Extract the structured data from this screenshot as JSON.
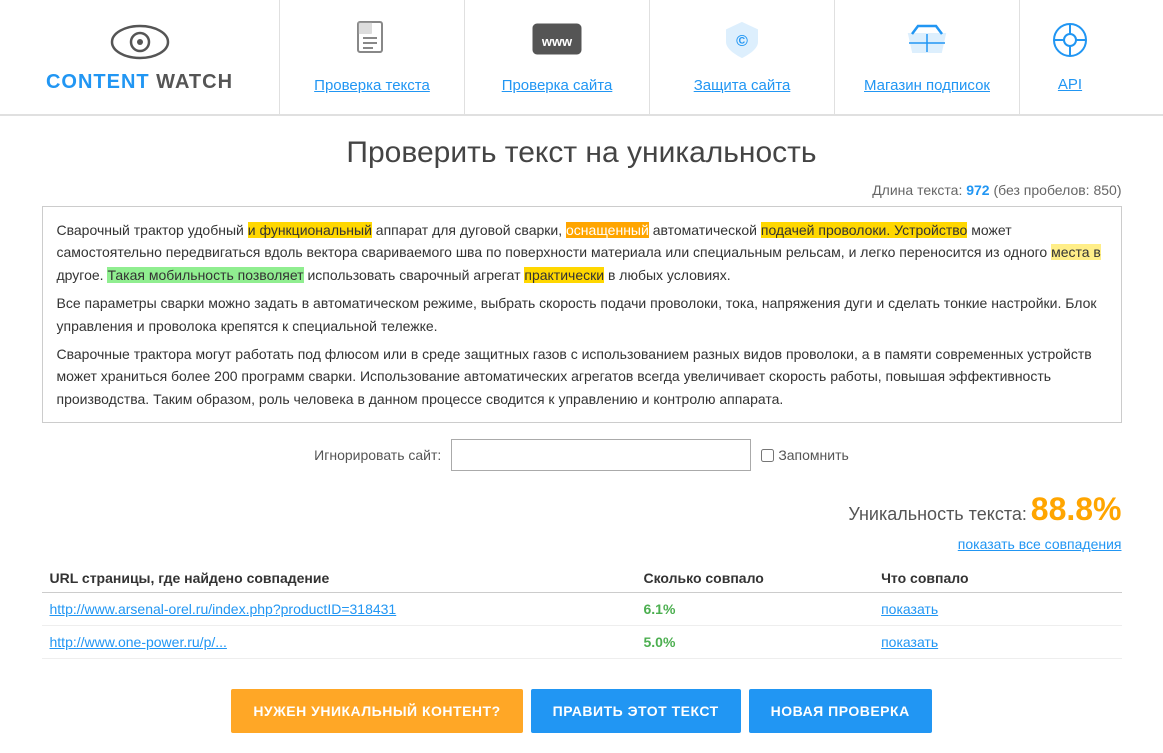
{
  "header": {
    "logo": {
      "text_content": "CONTENT WATCH",
      "text_cyan": "CONTENT",
      "text_gray": " WATCH"
    },
    "nav": [
      {
        "id": "check-text",
        "label": "Проверка текста",
        "icon": "doc"
      },
      {
        "id": "check-site",
        "label": "Проверка сайта",
        "icon": "www"
      },
      {
        "id": "protect-site",
        "label": "Защита сайта",
        "icon": "shield"
      },
      {
        "id": "shop",
        "label": "Магазин подписок",
        "icon": "basket"
      },
      {
        "id": "api",
        "label": "API",
        "icon": "api"
      }
    ]
  },
  "page": {
    "title": "Проверить текст на уникальность",
    "text_length_label": "Длина текста:",
    "text_length_num": "972",
    "text_nospace_label": "(без пробелов:",
    "text_nospace_num": "850)"
  },
  "ignore": {
    "label": "Игнорировать сайт:",
    "placeholder": "",
    "remember_label": "Запомнить"
  },
  "result": {
    "uniqueness_label": "Уникальность текста:",
    "uniqueness_value": "88.8%",
    "show_all_label": "показать все совпадения"
  },
  "table": {
    "headers": [
      "URL страницы, где найдено совпадение",
      "Сколько совпало",
      "Что совпало"
    ],
    "rows": [
      {
        "url": "http://www.arsenal-orel.ru/index.php?productID=318431",
        "match_pct": "6.1%",
        "show_label": "показать"
      },
      {
        "url": "http://www.one-power.ru/p/...",
        "match_pct": "5.0%",
        "show_label": "показать"
      }
    ]
  },
  "buttons": [
    {
      "id": "need-unique",
      "label": "НУЖЕН УНИКАЛЬНЫЙ КОНТЕНТ?",
      "style": "orange"
    },
    {
      "id": "edit-text",
      "label": "ПРАВИТЬ ЭТОТ ТЕКСТ",
      "style": "blue"
    },
    {
      "id": "new-check",
      "label": "НОВАЯ ПРОВЕРКА",
      "style": "blue"
    }
  ]
}
